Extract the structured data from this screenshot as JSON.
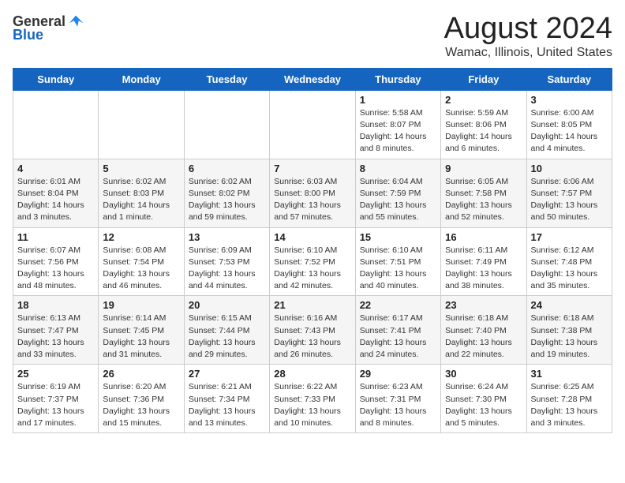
{
  "logo": {
    "general": "General",
    "blue": "Blue"
  },
  "title": "August 2024",
  "subtitle": "Wamac, Illinois, United States",
  "days_of_week": [
    "Sunday",
    "Monday",
    "Tuesday",
    "Wednesday",
    "Thursday",
    "Friday",
    "Saturday"
  ],
  "weeks": [
    [
      {
        "day": "",
        "info": ""
      },
      {
        "day": "",
        "info": ""
      },
      {
        "day": "",
        "info": ""
      },
      {
        "day": "",
        "info": ""
      },
      {
        "day": "1",
        "info": "Sunrise: 5:58 AM\nSunset: 8:07 PM\nDaylight: 14 hours\nand 8 minutes."
      },
      {
        "day": "2",
        "info": "Sunrise: 5:59 AM\nSunset: 8:06 PM\nDaylight: 14 hours\nand 6 minutes."
      },
      {
        "day": "3",
        "info": "Sunrise: 6:00 AM\nSunset: 8:05 PM\nDaylight: 14 hours\nand 4 minutes."
      }
    ],
    [
      {
        "day": "4",
        "info": "Sunrise: 6:01 AM\nSunset: 8:04 PM\nDaylight: 14 hours\nand 3 minutes."
      },
      {
        "day": "5",
        "info": "Sunrise: 6:02 AM\nSunset: 8:03 PM\nDaylight: 14 hours\nand 1 minute."
      },
      {
        "day": "6",
        "info": "Sunrise: 6:02 AM\nSunset: 8:02 PM\nDaylight: 13 hours\nand 59 minutes."
      },
      {
        "day": "7",
        "info": "Sunrise: 6:03 AM\nSunset: 8:00 PM\nDaylight: 13 hours\nand 57 minutes."
      },
      {
        "day": "8",
        "info": "Sunrise: 6:04 AM\nSunset: 7:59 PM\nDaylight: 13 hours\nand 55 minutes."
      },
      {
        "day": "9",
        "info": "Sunrise: 6:05 AM\nSunset: 7:58 PM\nDaylight: 13 hours\nand 52 minutes."
      },
      {
        "day": "10",
        "info": "Sunrise: 6:06 AM\nSunset: 7:57 PM\nDaylight: 13 hours\nand 50 minutes."
      }
    ],
    [
      {
        "day": "11",
        "info": "Sunrise: 6:07 AM\nSunset: 7:56 PM\nDaylight: 13 hours\nand 48 minutes."
      },
      {
        "day": "12",
        "info": "Sunrise: 6:08 AM\nSunset: 7:54 PM\nDaylight: 13 hours\nand 46 minutes."
      },
      {
        "day": "13",
        "info": "Sunrise: 6:09 AM\nSunset: 7:53 PM\nDaylight: 13 hours\nand 44 minutes."
      },
      {
        "day": "14",
        "info": "Sunrise: 6:10 AM\nSunset: 7:52 PM\nDaylight: 13 hours\nand 42 minutes."
      },
      {
        "day": "15",
        "info": "Sunrise: 6:10 AM\nSunset: 7:51 PM\nDaylight: 13 hours\nand 40 minutes."
      },
      {
        "day": "16",
        "info": "Sunrise: 6:11 AM\nSunset: 7:49 PM\nDaylight: 13 hours\nand 38 minutes."
      },
      {
        "day": "17",
        "info": "Sunrise: 6:12 AM\nSunset: 7:48 PM\nDaylight: 13 hours\nand 35 minutes."
      }
    ],
    [
      {
        "day": "18",
        "info": "Sunrise: 6:13 AM\nSunset: 7:47 PM\nDaylight: 13 hours\nand 33 minutes."
      },
      {
        "day": "19",
        "info": "Sunrise: 6:14 AM\nSunset: 7:45 PM\nDaylight: 13 hours\nand 31 minutes."
      },
      {
        "day": "20",
        "info": "Sunrise: 6:15 AM\nSunset: 7:44 PM\nDaylight: 13 hours\nand 29 minutes."
      },
      {
        "day": "21",
        "info": "Sunrise: 6:16 AM\nSunset: 7:43 PM\nDaylight: 13 hours\nand 26 minutes."
      },
      {
        "day": "22",
        "info": "Sunrise: 6:17 AM\nSunset: 7:41 PM\nDaylight: 13 hours\nand 24 minutes."
      },
      {
        "day": "23",
        "info": "Sunrise: 6:18 AM\nSunset: 7:40 PM\nDaylight: 13 hours\nand 22 minutes."
      },
      {
        "day": "24",
        "info": "Sunrise: 6:18 AM\nSunset: 7:38 PM\nDaylight: 13 hours\nand 19 minutes."
      }
    ],
    [
      {
        "day": "25",
        "info": "Sunrise: 6:19 AM\nSunset: 7:37 PM\nDaylight: 13 hours\nand 17 minutes."
      },
      {
        "day": "26",
        "info": "Sunrise: 6:20 AM\nSunset: 7:36 PM\nDaylight: 13 hours\nand 15 minutes."
      },
      {
        "day": "27",
        "info": "Sunrise: 6:21 AM\nSunset: 7:34 PM\nDaylight: 13 hours\nand 13 minutes."
      },
      {
        "day": "28",
        "info": "Sunrise: 6:22 AM\nSunset: 7:33 PM\nDaylight: 13 hours\nand 10 minutes."
      },
      {
        "day": "29",
        "info": "Sunrise: 6:23 AM\nSunset: 7:31 PM\nDaylight: 13 hours\nand 8 minutes."
      },
      {
        "day": "30",
        "info": "Sunrise: 6:24 AM\nSunset: 7:30 PM\nDaylight: 13 hours\nand 5 minutes."
      },
      {
        "day": "31",
        "info": "Sunrise: 6:25 AM\nSunset: 7:28 PM\nDaylight: 13 hours\nand 3 minutes."
      }
    ]
  ]
}
